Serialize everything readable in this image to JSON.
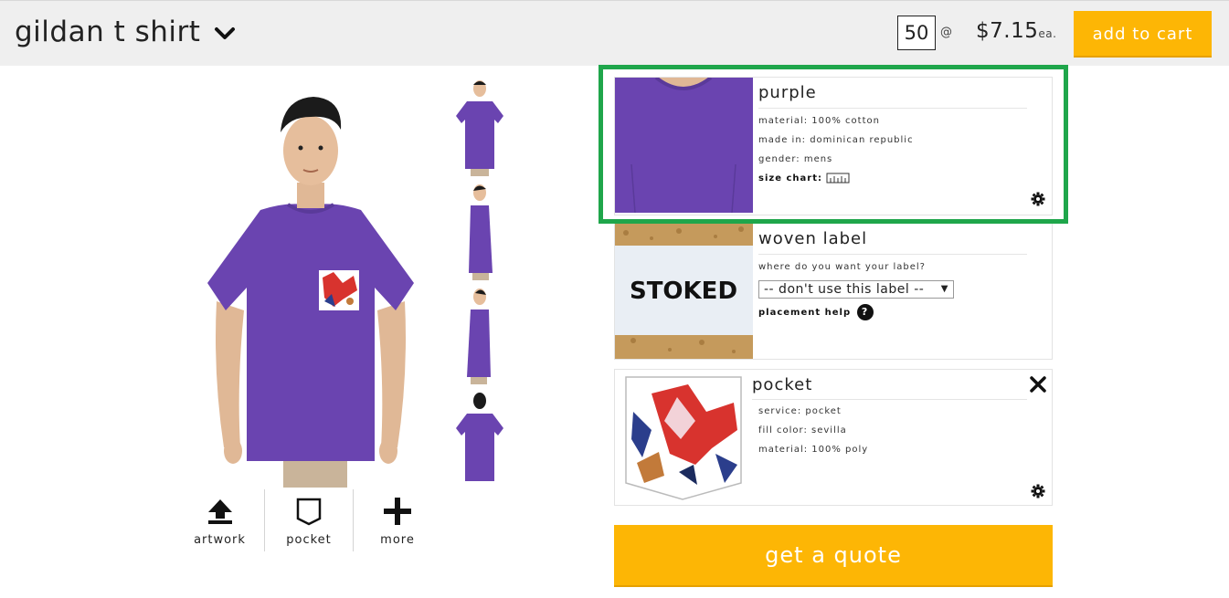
{
  "header": {
    "title": "gildan t shirt",
    "quantity": "50",
    "at": "@",
    "price": "$7.15",
    "price_suffix": "ea.",
    "add_to_cart": "add to cart"
  },
  "tools": [
    {
      "label": "artwork",
      "icon": "upload-icon"
    },
    {
      "label": "pocket",
      "icon": "pocket-icon"
    },
    {
      "label": "more",
      "icon": "plus-icon"
    }
  ],
  "cards": {
    "color": {
      "title": "purple",
      "material": "material: 100% cotton",
      "made_in": "made in: dominican republic",
      "gender": "gender: mens",
      "size_chart": "size chart:"
    },
    "label": {
      "title": "woven label",
      "question": "where do you want your label?",
      "selected": "-- don't use this label --",
      "placement_help": "placement help",
      "help_glyph": "?",
      "label_text": "STOKED"
    },
    "pocket": {
      "title": "pocket",
      "service": "service: pocket",
      "fill_color": "fill color: sevilla",
      "material": "material: 100% poly"
    }
  },
  "quote_button": "get a quote",
  "colors": {
    "accent": "#fdb605",
    "shirt": "#6a44b0",
    "highlight": "#1fa64b"
  }
}
